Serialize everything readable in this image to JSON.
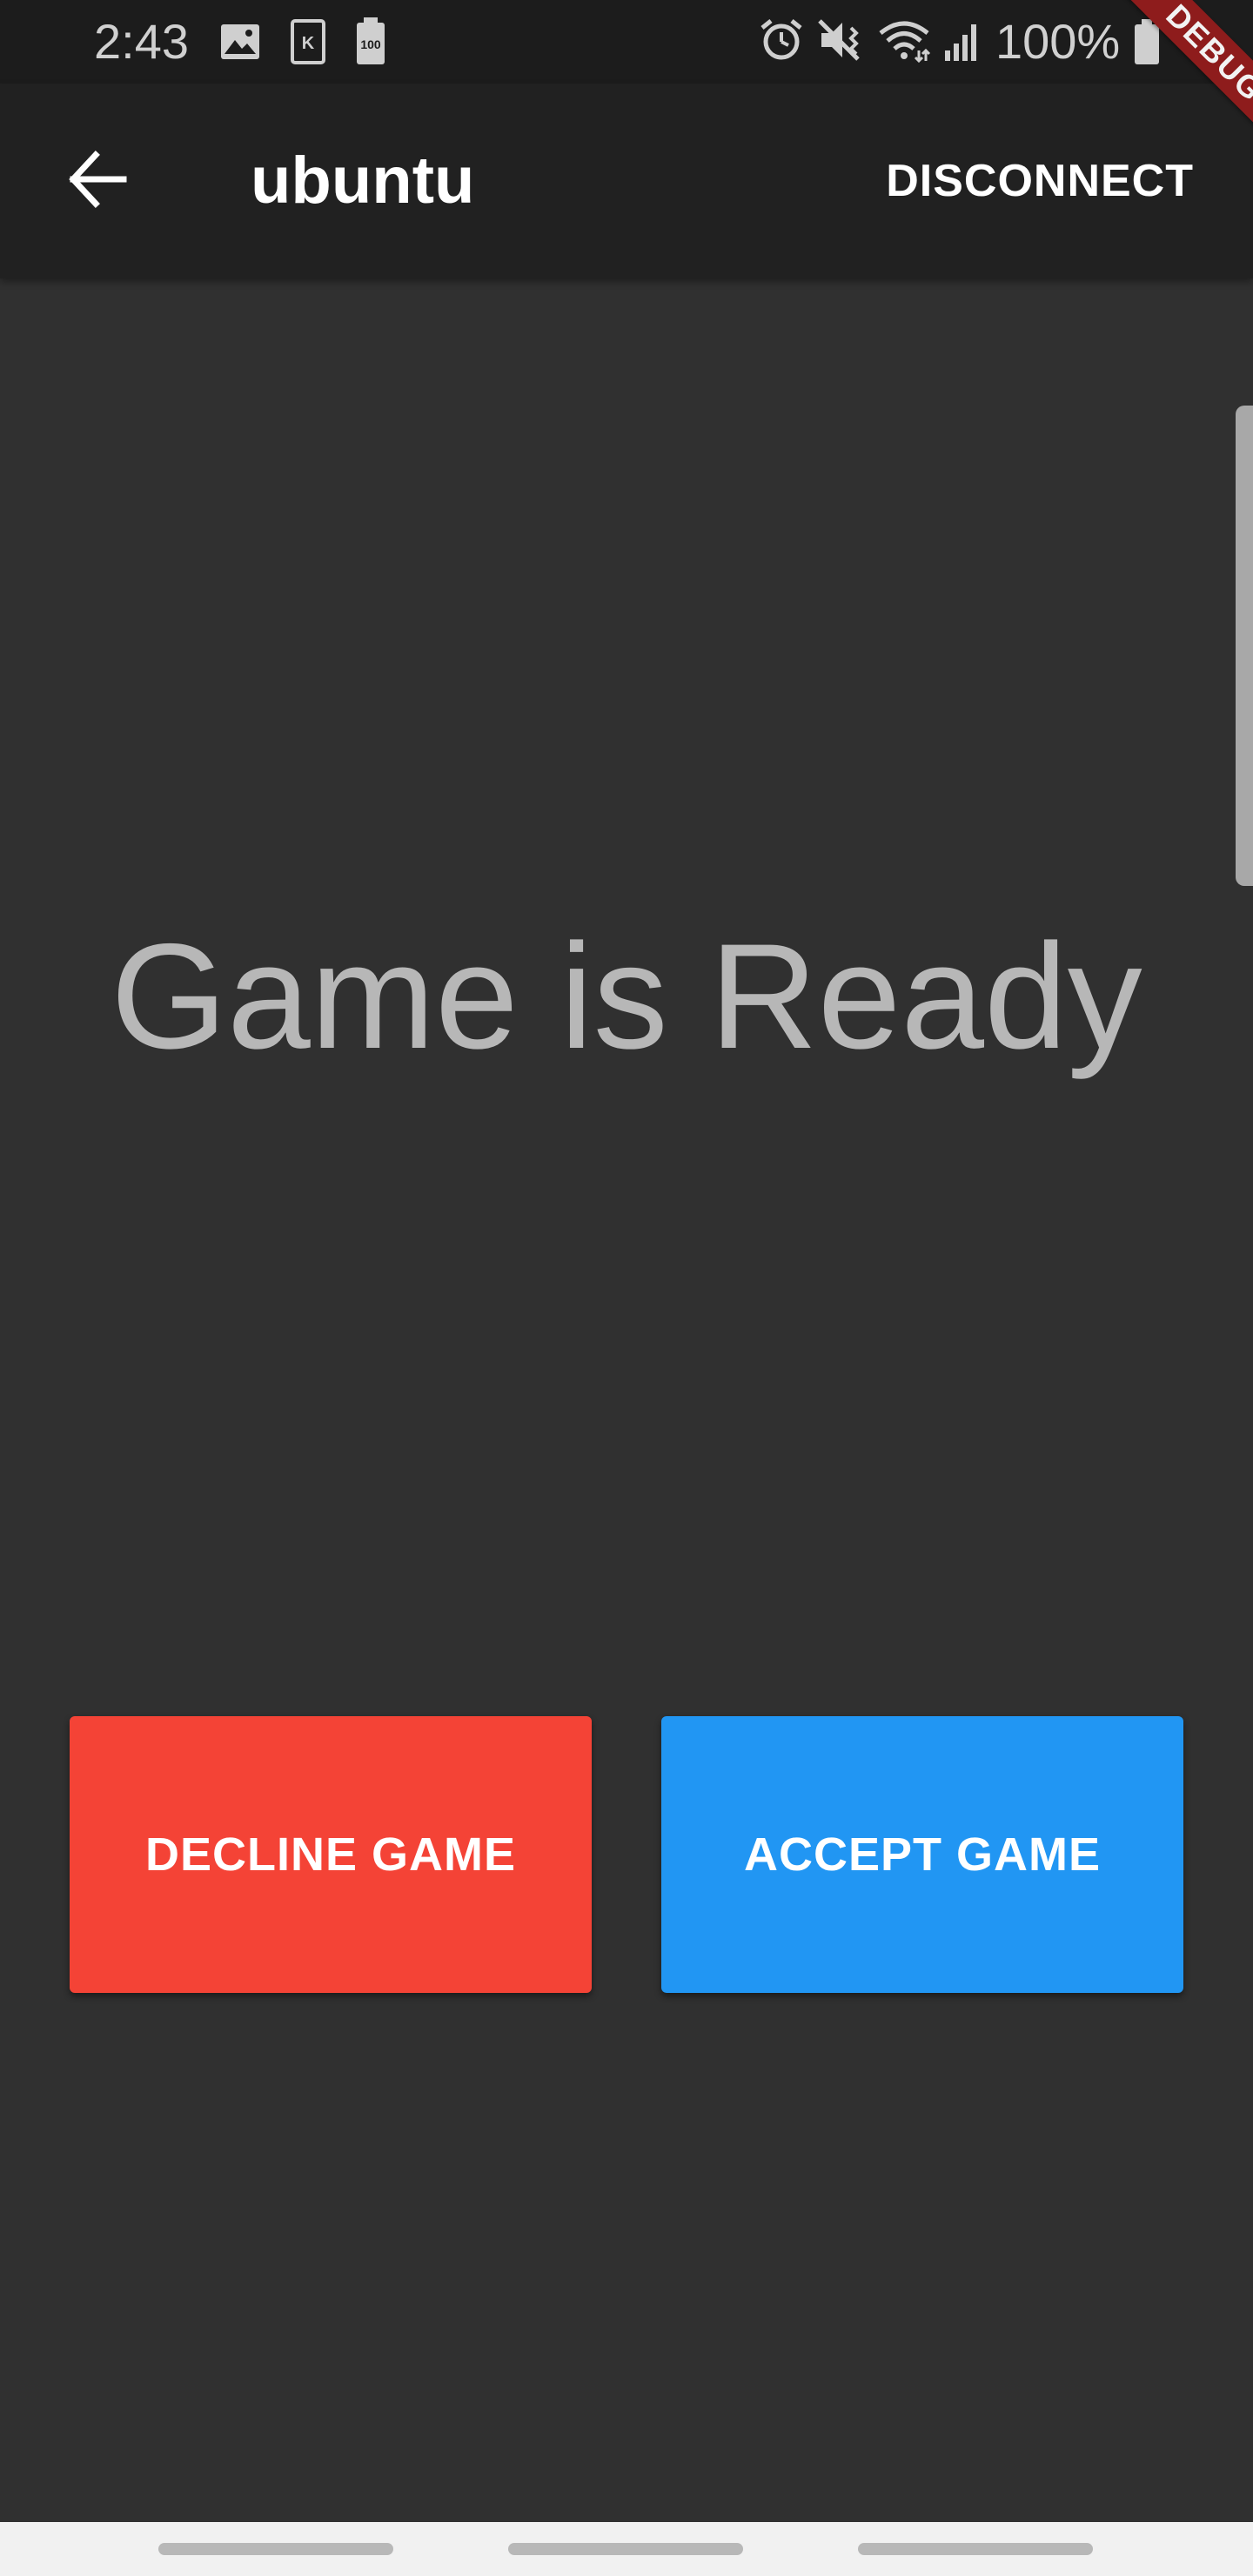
{
  "status_bar": {
    "time": "2:43",
    "battery_percent": "100%",
    "icons_left": [
      "image-icon",
      "k-icon",
      "battery-saver-icon"
    ],
    "icon_badge_k": "K",
    "icon_badge_100": "100",
    "icons_right": [
      "alarm-icon",
      "vibrate-icon",
      "wifi-icon",
      "signal-icon"
    ]
  },
  "debug_banner": "DEBUG",
  "app_bar": {
    "title": "ubuntu",
    "back_icon": "arrow-back-icon",
    "action_label": "DISCONNECT"
  },
  "main": {
    "headline": "Game is Ready",
    "decline_label": "DECLINE GAME",
    "accept_label": "ACCEPT GAME"
  },
  "colors": {
    "background": "#303030",
    "app_bar": "#212121",
    "decline": "#f44336",
    "accept": "#2196f3",
    "debug": "#8e1c1c"
  }
}
